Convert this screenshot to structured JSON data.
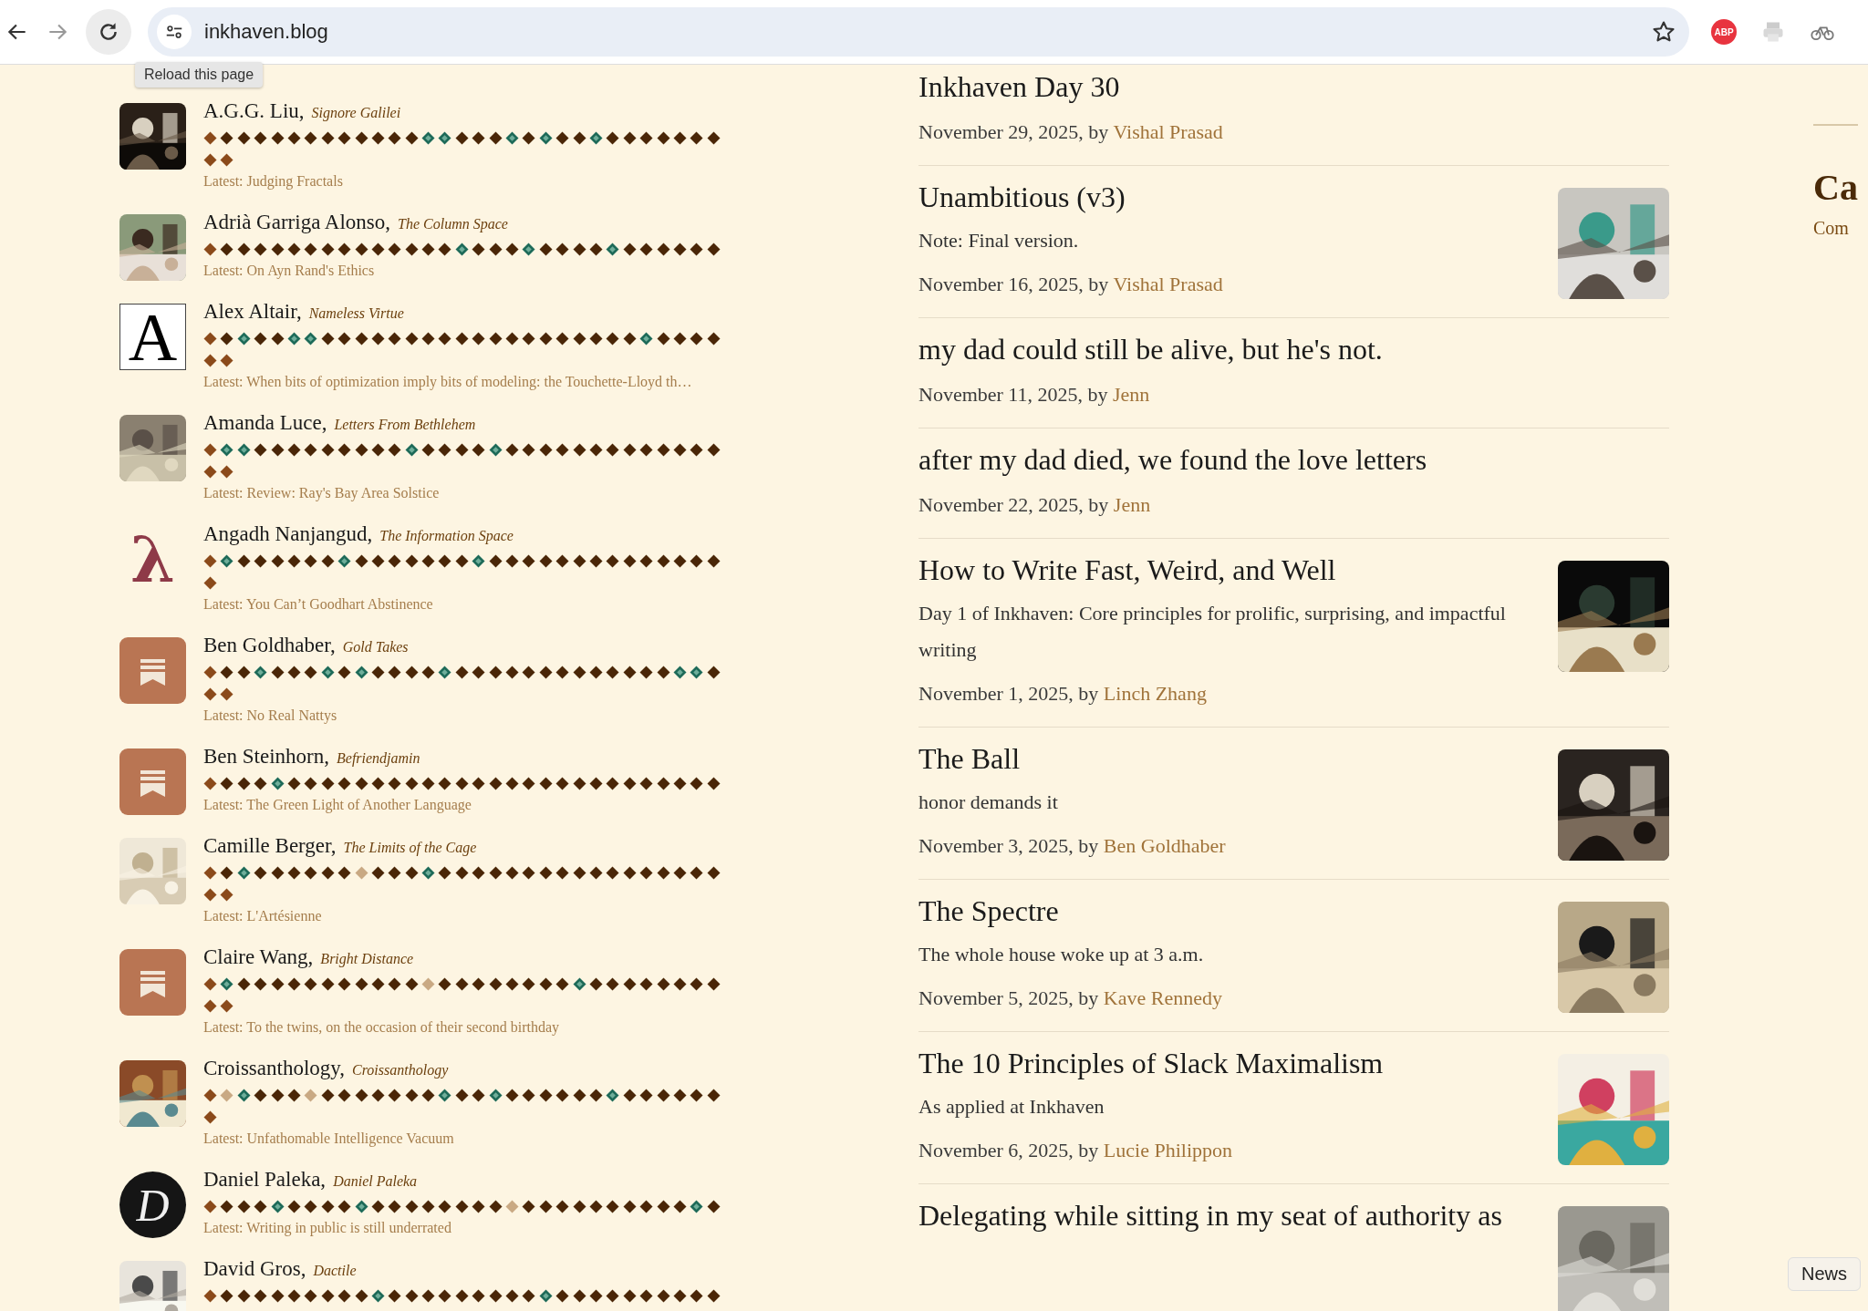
{
  "browser": {
    "url": "inkhaven.blog",
    "tooltip": "Reload this page",
    "extensions": [
      {
        "kind": "badge",
        "label": "ABP"
      },
      {
        "kind": "printer"
      },
      {
        "kind": "cycle"
      }
    ]
  },
  "writers": [
    {
      "name": "A.G.G. Liu,",
      "blog": "Signore Galilei",
      "latest": "Latest: Judging Fractals",
      "avatar": {
        "kind": "picture"
      },
      "days": [
        {
          "kind": "bonus"
        },
        {
          "kind": "post"
        },
        {
          "kind": "post"
        },
        {
          "kind": "post"
        },
        {
          "kind": "post"
        },
        {
          "kind": "post"
        },
        {
          "kind": "post"
        },
        {
          "kind": "post"
        },
        {
          "kind": "post"
        },
        {
          "kind": "post"
        },
        {
          "kind": "post"
        },
        {
          "kind": "post"
        },
        {
          "kind": "post"
        },
        {
          "kind": "featured"
        },
        {
          "kind": "featured"
        },
        {
          "kind": "post"
        },
        {
          "kind": "post"
        },
        {
          "kind": "post"
        },
        {
          "kind": "featured"
        },
        {
          "kind": "post"
        },
        {
          "kind": "featured"
        },
        {
          "kind": "post"
        },
        {
          "kind": "post"
        },
        {
          "kind": "featured"
        },
        {
          "kind": "post"
        },
        {
          "kind": "post"
        },
        {
          "kind": "post"
        },
        {
          "kind": "post"
        },
        {
          "kind": "post"
        },
        {
          "kind": "post"
        },
        {
          "kind": "post"
        },
        {
          "kind": "bonus"
        },
        {
          "kind": "bonus"
        }
      ]
    },
    {
      "name": "Adrià Garriga Alonso,",
      "blog": "The Column Space",
      "latest": "Latest: On Ayn Rand's Ethics",
      "avatar": {
        "kind": "picture"
      },
      "days": [
        {
          "kind": "bonus"
        },
        {
          "kind": "post"
        },
        {
          "kind": "post"
        },
        {
          "kind": "post"
        },
        {
          "kind": "post"
        },
        {
          "kind": "post"
        },
        {
          "kind": "post"
        },
        {
          "kind": "post"
        },
        {
          "kind": "post"
        },
        {
          "kind": "post"
        },
        {
          "kind": "post"
        },
        {
          "kind": "post"
        },
        {
          "kind": "post"
        },
        {
          "kind": "post"
        },
        {
          "kind": "post"
        },
        {
          "kind": "featured"
        },
        {
          "kind": "post"
        },
        {
          "kind": "post"
        },
        {
          "kind": "post"
        },
        {
          "kind": "featured"
        },
        {
          "kind": "post"
        },
        {
          "kind": "post"
        },
        {
          "kind": "post"
        },
        {
          "kind": "post"
        },
        {
          "kind": "featured"
        },
        {
          "kind": "post"
        },
        {
          "kind": "post"
        },
        {
          "kind": "post"
        },
        {
          "kind": "post"
        },
        {
          "kind": "post"
        },
        {
          "kind": "post"
        }
      ]
    },
    {
      "name": "Alex Altair,",
      "blog": "Nameless Virtue",
      "latest": "Latest: When bits of optimization imply bits of modeling: the Touchette-Lloyd th…",
      "avatar": {
        "kind": "letter",
        "letter": "A"
      },
      "days": [
        {
          "kind": "bonus"
        },
        {
          "kind": "post"
        },
        {
          "kind": "featured"
        },
        {
          "kind": "post"
        },
        {
          "kind": "post"
        },
        {
          "kind": "featured"
        },
        {
          "kind": "featured"
        },
        {
          "kind": "post"
        },
        {
          "kind": "post"
        },
        {
          "kind": "post"
        },
        {
          "kind": "post"
        },
        {
          "kind": "post"
        },
        {
          "kind": "post"
        },
        {
          "kind": "post"
        },
        {
          "kind": "post"
        },
        {
          "kind": "post"
        },
        {
          "kind": "post"
        },
        {
          "kind": "post"
        },
        {
          "kind": "post"
        },
        {
          "kind": "post"
        },
        {
          "kind": "post"
        },
        {
          "kind": "post"
        },
        {
          "kind": "post"
        },
        {
          "kind": "post"
        },
        {
          "kind": "post"
        },
        {
          "kind": "post"
        },
        {
          "kind": "featured"
        },
        {
          "kind": "post"
        },
        {
          "kind": "post"
        },
        {
          "kind": "post"
        },
        {
          "kind": "post"
        },
        {
          "kind": "bonus"
        },
        {
          "kind": "bonus"
        }
      ]
    },
    {
      "name": "Amanda Luce,",
      "blog": "Letters From Bethlehem",
      "latest": "Latest: Review: Ray's Bay Area Solstice",
      "avatar": {
        "kind": "picture"
      },
      "days": [
        {
          "kind": "bonus"
        },
        {
          "kind": "featured"
        },
        {
          "kind": "featured"
        },
        {
          "kind": "post"
        },
        {
          "kind": "post"
        },
        {
          "kind": "post"
        },
        {
          "kind": "post"
        },
        {
          "kind": "post"
        },
        {
          "kind": "post"
        },
        {
          "kind": "post"
        },
        {
          "kind": "post"
        },
        {
          "kind": "post"
        },
        {
          "kind": "featured"
        },
        {
          "kind": "post"
        },
        {
          "kind": "post"
        },
        {
          "kind": "post"
        },
        {
          "kind": "post"
        },
        {
          "kind": "featured"
        },
        {
          "kind": "post"
        },
        {
          "kind": "post"
        },
        {
          "kind": "post"
        },
        {
          "kind": "post"
        },
        {
          "kind": "post"
        },
        {
          "kind": "post"
        },
        {
          "kind": "post"
        },
        {
          "kind": "post"
        },
        {
          "kind": "post"
        },
        {
          "kind": "post"
        },
        {
          "kind": "post"
        },
        {
          "kind": "post"
        },
        {
          "kind": "post"
        },
        {
          "kind": "bonus"
        },
        {
          "kind": "bonus"
        }
      ]
    },
    {
      "name": "Angadh Nanjangud,",
      "blog": "The Information Space",
      "latest": "Latest: You Can’t Goodhart Abstinence",
      "avatar": {
        "kind": "glyph",
        "letter": "λ"
      },
      "days": [
        {
          "kind": "bonus"
        },
        {
          "kind": "featured"
        },
        {
          "kind": "post"
        },
        {
          "kind": "post"
        },
        {
          "kind": "post"
        },
        {
          "kind": "post"
        },
        {
          "kind": "post"
        },
        {
          "kind": "post"
        },
        {
          "kind": "featured"
        },
        {
          "kind": "post"
        },
        {
          "kind": "post"
        },
        {
          "kind": "post"
        },
        {
          "kind": "post"
        },
        {
          "kind": "post"
        },
        {
          "kind": "post"
        },
        {
          "kind": "post"
        },
        {
          "kind": "featured"
        },
        {
          "kind": "post"
        },
        {
          "kind": "post"
        },
        {
          "kind": "post"
        },
        {
          "kind": "post"
        },
        {
          "kind": "post"
        },
        {
          "kind": "post"
        },
        {
          "kind": "post"
        },
        {
          "kind": "post"
        },
        {
          "kind": "post"
        },
        {
          "kind": "post"
        },
        {
          "kind": "post"
        },
        {
          "kind": "post"
        },
        {
          "kind": "post"
        },
        {
          "kind": "post"
        },
        {
          "kind": "bonus"
        }
      ]
    },
    {
      "name": "Ben Goldhaber,",
      "blog": "Gold Takes",
      "latest": "Latest: No Real Nattys",
      "avatar": {
        "kind": "bookmark"
      },
      "days": [
        {
          "kind": "bonus"
        },
        {
          "kind": "post"
        },
        {
          "kind": "post"
        },
        {
          "kind": "featured"
        },
        {
          "kind": "post"
        },
        {
          "kind": "post"
        },
        {
          "kind": "post"
        },
        {
          "kind": "featured"
        },
        {
          "kind": "post"
        },
        {
          "kind": "featured"
        },
        {
          "kind": "post"
        },
        {
          "kind": "post"
        },
        {
          "kind": "post"
        },
        {
          "kind": "post"
        },
        {
          "kind": "featured"
        },
        {
          "kind": "post"
        },
        {
          "kind": "post"
        },
        {
          "kind": "post"
        },
        {
          "kind": "post"
        },
        {
          "kind": "post"
        },
        {
          "kind": "post"
        },
        {
          "kind": "post"
        },
        {
          "kind": "post"
        },
        {
          "kind": "post"
        },
        {
          "kind": "post"
        },
        {
          "kind": "post"
        },
        {
          "kind": "post"
        },
        {
          "kind": "post"
        },
        {
          "kind": "featured"
        },
        {
          "kind": "featured"
        },
        {
          "kind": "post"
        },
        {
          "kind": "bonus"
        },
        {
          "kind": "bonus"
        }
      ]
    },
    {
      "name": "Ben Steinhorn,",
      "blog": "Befriendjamin",
      "latest": "Latest: The Green Light of Another Language",
      "avatar": {
        "kind": "bookmark"
      },
      "days": [
        {
          "kind": "bonus"
        },
        {
          "kind": "post"
        },
        {
          "kind": "post"
        },
        {
          "kind": "post"
        },
        {
          "kind": "featured"
        },
        {
          "kind": "post"
        },
        {
          "kind": "post"
        },
        {
          "kind": "post"
        },
        {
          "kind": "post"
        },
        {
          "kind": "post"
        },
        {
          "kind": "post"
        },
        {
          "kind": "post"
        },
        {
          "kind": "post"
        },
        {
          "kind": "post"
        },
        {
          "kind": "post"
        },
        {
          "kind": "post"
        },
        {
          "kind": "post"
        },
        {
          "kind": "post"
        },
        {
          "kind": "post"
        },
        {
          "kind": "post"
        },
        {
          "kind": "post"
        },
        {
          "kind": "post"
        },
        {
          "kind": "post"
        },
        {
          "kind": "post"
        },
        {
          "kind": "post"
        },
        {
          "kind": "post"
        },
        {
          "kind": "post"
        },
        {
          "kind": "post"
        },
        {
          "kind": "post"
        },
        {
          "kind": "post"
        },
        {
          "kind": "post"
        }
      ]
    },
    {
      "name": "Camille Berger,",
      "blog": "The Limits of the Cage",
      "latest": "Latest: L'Artésienne",
      "avatar": {
        "kind": "picture"
      },
      "days": [
        {
          "kind": "bonus"
        },
        {
          "kind": "post"
        },
        {
          "kind": "featured"
        },
        {
          "kind": "post"
        },
        {
          "kind": "post"
        },
        {
          "kind": "post"
        },
        {
          "kind": "post"
        },
        {
          "kind": "post"
        },
        {
          "kind": "post"
        },
        {
          "kind": "missed"
        },
        {
          "kind": "post"
        },
        {
          "kind": "post"
        },
        {
          "kind": "post"
        },
        {
          "kind": "featured"
        },
        {
          "kind": "post"
        },
        {
          "kind": "post"
        },
        {
          "kind": "post"
        },
        {
          "kind": "post"
        },
        {
          "kind": "post"
        },
        {
          "kind": "post"
        },
        {
          "kind": "post"
        },
        {
          "kind": "post"
        },
        {
          "kind": "post"
        },
        {
          "kind": "post"
        },
        {
          "kind": "post"
        },
        {
          "kind": "post"
        },
        {
          "kind": "post"
        },
        {
          "kind": "post"
        },
        {
          "kind": "post"
        },
        {
          "kind": "post"
        },
        {
          "kind": "post"
        },
        {
          "kind": "bonus"
        },
        {
          "kind": "bonus"
        }
      ]
    },
    {
      "name": "Claire Wang,",
      "blog": "Bright Distance",
      "latest": "Latest: To the twins, on the occasion of their second birthday",
      "avatar": {
        "kind": "bookmark"
      },
      "days": [
        {
          "kind": "bonus"
        },
        {
          "kind": "featured"
        },
        {
          "kind": "post"
        },
        {
          "kind": "post"
        },
        {
          "kind": "post"
        },
        {
          "kind": "post"
        },
        {
          "kind": "post"
        },
        {
          "kind": "post"
        },
        {
          "kind": "post"
        },
        {
          "kind": "post"
        },
        {
          "kind": "post"
        },
        {
          "kind": "post"
        },
        {
          "kind": "post"
        },
        {
          "kind": "missed"
        },
        {
          "kind": "post"
        },
        {
          "kind": "post"
        },
        {
          "kind": "post"
        },
        {
          "kind": "post"
        },
        {
          "kind": "post"
        },
        {
          "kind": "post"
        },
        {
          "kind": "post"
        },
        {
          "kind": "post"
        },
        {
          "kind": "featured"
        },
        {
          "kind": "post"
        },
        {
          "kind": "post"
        },
        {
          "kind": "post"
        },
        {
          "kind": "post"
        },
        {
          "kind": "post"
        },
        {
          "kind": "post"
        },
        {
          "kind": "post"
        },
        {
          "kind": "post"
        },
        {
          "kind": "bonus"
        },
        {
          "kind": "bonus"
        }
      ]
    },
    {
      "name": "Croissanthology,",
      "blog": "Croissanthology",
      "latest": "Latest: Unfathomable Intelligence Vacuum",
      "avatar": {
        "kind": "picture"
      },
      "days": [
        {
          "kind": "bonus"
        },
        {
          "kind": "missed"
        },
        {
          "kind": "featured"
        },
        {
          "kind": "post"
        },
        {
          "kind": "post"
        },
        {
          "kind": "post"
        },
        {
          "kind": "missed"
        },
        {
          "kind": "post"
        },
        {
          "kind": "post"
        },
        {
          "kind": "post"
        },
        {
          "kind": "post"
        },
        {
          "kind": "post"
        },
        {
          "kind": "post"
        },
        {
          "kind": "post"
        },
        {
          "kind": "featured"
        },
        {
          "kind": "post"
        },
        {
          "kind": "post"
        },
        {
          "kind": "featured"
        },
        {
          "kind": "post"
        },
        {
          "kind": "post"
        },
        {
          "kind": "post"
        },
        {
          "kind": "post"
        },
        {
          "kind": "post"
        },
        {
          "kind": "post"
        },
        {
          "kind": "featured"
        },
        {
          "kind": "post"
        },
        {
          "kind": "post"
        },
        {
          "kind": "post"
        },
        {
          "kind": "post"
        },
        {
          "kind": "post"
        },
        {
          "kind": "post"
        },
        {
          "kind": "bonus"
        }
      ]
    },
    {
      "name": "Daniel Paleka,",
      "blog": "Daniel Paleka",
      "latest": "Latest: Writing in public is still underrated",
      "avatar": {
        "kind": "circle",
        "letter": "D"
      },
      "days": [
        {
          "kind": "bonus"
        },
        {
          "kind": "post"
        },
        {
          "kind": "post"
        },
        {
          "kind": "post"
        },
        {
          "kind": "featured"
        },
        {
          "kind": "post"
        },
        {
          "kind": "post"
        },
        {
          "kind": "post"
        },
        {
          "kind": "post"
        },
        {
          "kind": "featured"
        },
        {
          "kind": "post"
        },
        {
          "kind": "post"
        },
        {
          "kind": "post"
        },
        {
          "kind": "post"
        },
        {
          "kind": "post"
        },
        {
          "kind": "post"
        },
        {
          "kind": "post"
        },
        {
          "kind": "post"
        },
        {
          "kind": "missed"
        },
        {
          "kind": "post"
        },
        {
          "kind": "post"
        },
        {
          "kind": "post"
        },
        {
          "kind": "post"
        },
        {
          "kind": "post"
        },
        {
          "kind": "post"
        },
        {
          "kind": "post"
        },
        {
          "kind": "post"
        },
        {
          "kind": "post"
        },
        {
          "kind": "post"
        },
        {
          "kind": "featured"
        },
        {
          "kind": "post"
        }
      ]
    },
    {
      "name": "David Gros,",
      "blog": "Dactile",
      "avatar": {
        "kind": "picture"
      },
      "days": [
        {
          "kind": "bonus"
        },
        {
          "kind": "post"
        },
        {
          "kind": "post"
        },
        {
          "kind": "post"
        },
        {
          "kind": "post"
        },
        {
          "kind": "post"
        },
        {
          "kind": "post"
        },
        {
          "kind": "post"
        },
        {
          "kind": "post"
        },
        {
          "kind": "post"
        },
        {
          "kind": "featured"
        },
        {
          "kind": "post"
        },
        {
          "kind": "post"
        },
        {
          "kind": "post"
        },
        {
          "kind": "post"
        },
        {
          "kind": "post"
        },
        {
          "kind": "post"
        },
        {
          "kind": "post"
        },
        {
          "kind": "post"
        },
        {
          "kind": "post"
        },
        {
          "kind": "featured"
        },
        {
          "kind": "post"
        },
        {
          "kind": "post"
        },
        {
          "kind": "post"
        },
        {
          "kind": "post"
        },
        {
          "kind": "post"
        },
        {
          "kind": "post"
        },
        {
          "kind": "post"
        },
        {
          "kind": "post"
        },
        {
          "kind": "post"
        },
        {
          "kind": "post"
        }
      ]
    }
  ],
  "posts": [
    {
      "title": "Inkhaven Day 30",
      "date": "November 29, 2025, by",
      "author": "Vishal Prasad"
    },
    {
      "title": "Unambitious (v3)",
      "subtitle": "Note: Final version.",
      "date": "November 16, 2025, by",
      "author": "Vishal Prasad",
      "thumbnail": {
        "kind": "picture"
      }
    },
    {
      "title": "my dad could still be alive, but he's not.",
      "date": "November 11, 2025, by",
      "author": "Jenn"
    },
    {
      "title": "after my dad died, we found the love letters",
      "date": "November 22, 2025, by",
      "author": "Jenn"
    },
    {
      "title": "How to Write Fast, Weird, and Well",
      "subtitle": "Day 1 of Inkhaven: Core principles for prolific, surprising, and impactful writing",
      "date": "November 1, 2025, by",
      "author": "Linch Zhang",
      "thumbnail": {
        "kind": "picture"
      }
    },
    {
      "title": "The Ball",
      "subtitle": "honor demands it",
      "date": "November 3, 2025, by",
      "author": "Ben Goldhaber",
      "thumbnail": {
        "kind": "picture"
      }
    },
    {
      "title": "The Spectre",
      "subtitle": "The whole house woke up at 3 a.m.",
      "date": "November 5, 2025, by",
      "author": "Kave Rennedy",
      "thumbnail": {
        "kind": "picture"
      }
    },
    {
      "title": "The 10 Principles of Slack Maximalism",
      "subtitle": "As applied at Inkhaven",
      "date": "November 6, 2025, by",
      "author": "Lucie Philippon",
      "thumbnail": {
        "kind": "picture"
      }
    },
    {
      "title": "Delegating while sitting in my seat of authority as",
      "thumbnail": {
        "kind": "picture"
      }
    }
  ],
  "sidebar": {
    "heading": "Ca",
    "link": "Com"
  },
  "hover_label": "News"
}
